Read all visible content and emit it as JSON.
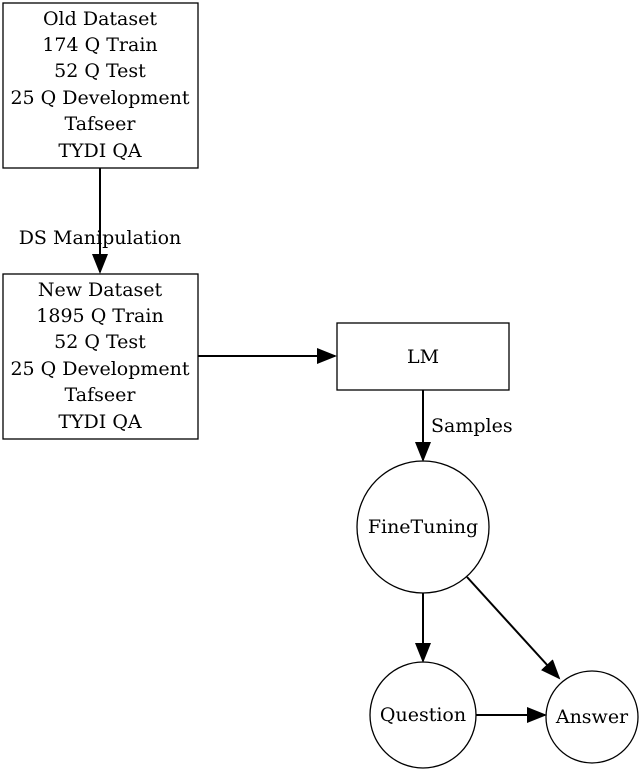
{
  "nodes": {
    "old_dataset": {
      "lines": [
        "Old Dataset",
        "174 Q Train",
        "52 Q Test",
        "25 Q Development",
        "Tafseer",
        "TYDI QA"
      ]
    },
    "new_dataset": {
      "lines": [
        "New Dataset",
        "1895 Q Train",
        "52 Q Test",
        "25 Q Development",
        "Tafseer",
        "TYDI QA"
      ]
    },
    "lm": {
      "label": "LM"
    },
    "finetuning": {
      "label": "FineTuning"
    },
    "question": {
      "label": "Question"
    },
    "answer": {
      "label": "Answer"
    }
  },
  "edges": {
    "ds_manipulation": {
      "label": "DS Manipulation"
    },
    "samples": {
      "label": "Samples"
    }
  }
}
